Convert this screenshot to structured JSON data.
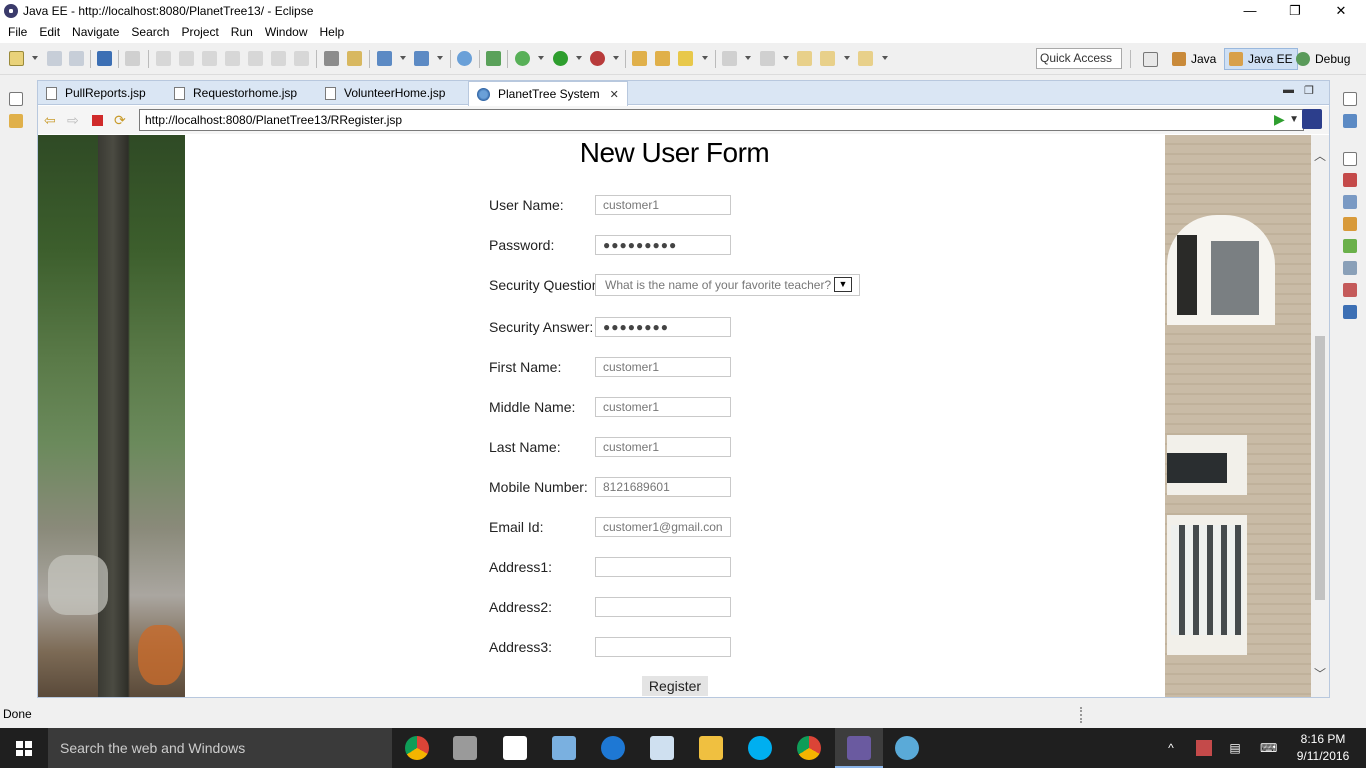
{
  "window": {
    "title": "Java EE - http://localhost:8080/PlanetTree13/ - Eclipse",
    "minimize": "—",
    "restore": "❐",
    "close": "✕"
  },
  "menu": [
    "File",
    "Edit",
    "Navigate",
    "Search",
    "Project",
    "Run",
    "Window",
    "Help"
  ],
  "toolbar": {
    "quick_access": "Quick Access",
    "perspectives": [
      "Java",
      "Java EE",
      "Debug"
    ]
  },
  "tabs": [
    {
      "label": "PullReports.jsp"
    },
    {
      "label": "Requestorhome.jsp"
    },
    {
      "label": "VolunteerHome.jsp"
    },
    {
      "label": "PlanetTree System",
      "close": "✕"
    }
  ],
  "browser": {
    "url": "http://localhost:8080/PlanetTree13/RRegister.jsp"
  },
  "form": {
    "title": "New User Form",
    "fields": [
      {
        "label": "User Name:",
        "value": "customer1"
      },
      {
        "label": "Password:",
        "value": "●●●●●●●●●"
      },
      {
        "label": "Security Question:",
        "value": "What is the name of your favorite teacher?"
      },
      {
        "label": "Security Answer:",
        "value": "●●●●●●●●"
      },
      {
        "label": "First Name:",
        "value": "customer1"
      },
      {
        "label": "Middle Name:",
        "value": "customer1"
      },
      {
        "label": "Last Name:",
        "value": "customer1"
      },
      {
        "label": "Mobile Number:",
        "value": "8121689601"
      },
      {
        "label": "Email Id:",
        "value": "customer1@gmail.con"
      },
      {
        "label": "Address1:",
        "value": ""
      },
      {
        "label": "Address2:",
        "value": ""
      },
      {
        "label": "Address3:",
        "value": ""
      }
    ],
    "submit": "Register"
  },
  "status": {
    "text": "Done"
  },
  "taskbar": {
    "search_placeholder": "Search the web and Windows",
    "time": "8:16 PM",
    "date": "9/11/2016"
  }
}
